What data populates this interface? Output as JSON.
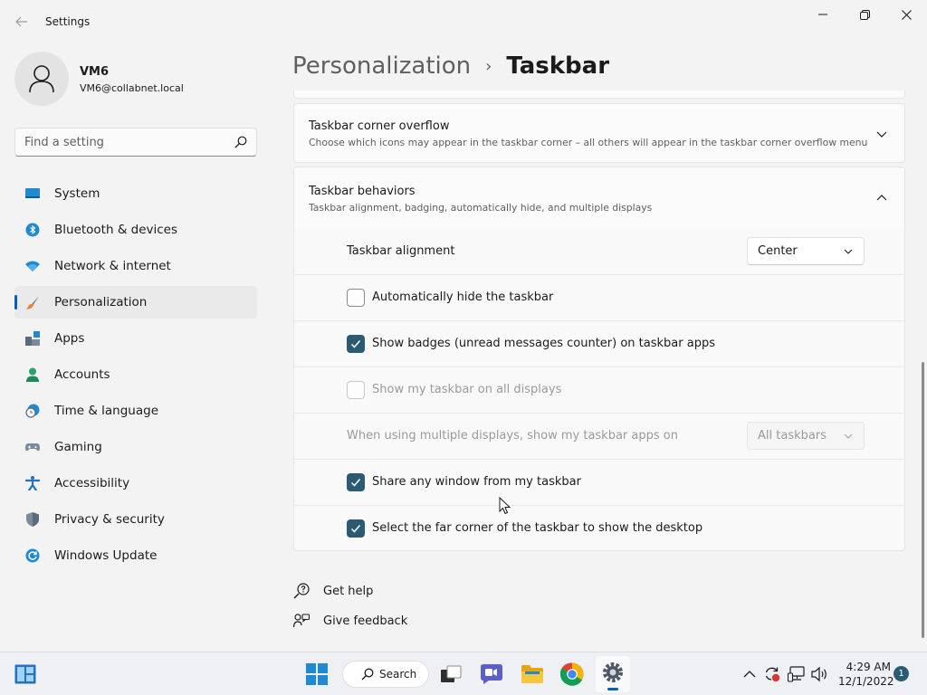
{
  "window": {
    "title": "Settings",
    "back_icon": "arrow-left-icon",
    "controls": [
      "minimize-icon",
      "restore-icon",
      "close-icon"
    ]
  },
  "profile": {
    "name": "VM6",
    "email": "VM6@collabnet.local"
  },
  "search": {
    "placeholder": "Find a setting",
    "icon": "search-icon"
  },
  "sidebar": {
    "items": [
      {
        "label": "System",
        "icon": "system-icon",
        "active": false
      },
      {
        "label": "Bluetooth & devices",
        "icon": "bluetooth-icon",
        "active": false
      },
      {
        "label": "Network & internet",
        "icon": "wifi-icon",
        "active": false
      },
      {
        "label": "Personalization",
        "icon": "brush-icon",
        "active": true
      },
      {
        "label": "Apps",
        "icon": "apps-icon",
        "active": false
      },
      {
        "label": "Accounts",
        "icon": "accounts-icon",
        "active": false
      },
      {
        "label": "Time & language",
        "icon": "clock-globe-icon",
        "active": false
      },
      {
        "label": "Gaming",
        "icon": "gamepad-icon",
        "active": false
      },
      {
        "label": "Accessibility",
        "icon": "accessibility-icon",
        "active": false
      },
      {
        "label": "Privacy & security",
        "icon": "shield-icon",
        "active": false
      },
      {
        "label": "Windows Update",
        "icon": "update-icon",
        "active": false
      }
    ],
    "accent_color": "#005fb8"
  },
  "breadcrumb": {
    "parent": "Personalization",
    "separator": "›",
    "current": "Taskbar"
  },
  "overflow_card": {
    "title": "Taskbar corner overflow",
    "description": "Choose which icons may appear in the taskbar corner – all others will appear in the taskbar corner overflow menu",
    "expanded": false
  },
  "behaviors_card": {
    "title": "Taskbar behaviors",
    "description": "Taskbar alignment, badging, automatically hide, and multiple displays",
    "expanded": true
  },
  "behaviors": {
    "alignment": {
      "label": "Taskbar alignment",
      "value": "Center",
      "enabled": true
    },
    "auto_hide": {
      "label": "Automatically hide the taskbar",
      "checked": false,
      "enabled": true
    },
    "badges": {
      "label": "Show badges (unread messages counter) on taskbar apps",
      "checked": true,
      "enabled": true
    },
    "all_displays": {
      "label": "Show my taskbar on all displays",
      "checked": false,
      "enabled": false
    },
    "multi_display": {
      "label": "When using multiple displays, show my taskbar apps on",
      "value": "All taskbars",
      "enabled": false
    },
    "share_window": {
      "label": "Share any window from my taskbar",
      "checked": true,
      "enabled": true
    },
    "far_corner": {
      "label": "Select the far corner of the taskbar to show the desktop",
      "checked": true,
      "enabled": true
    }
  },
  "help": {
    "get_help": "Get help",
    "give_feedback": "Give feedback"
  },
  "taskbar": {
    "search_label": "Search",
    "apps": [
      "start-icon",
      "task-view-icon",
      "chat-icon",
      "file-explorer-icon",
      "chrome-icon",
      "settings-icon"
    ],
    "tray_icons": [
      "chevron-up-icon",
      "sync-icon",
      "network-icon",
      "volume-icon"
    ],
    "time": "4:29 AM",
    "date": "12/1/2022",
    "notifications": "1"
  },
  "colors": {
    "checkbox_checked": "#2b5b73",
    "accent": "#005fb8",
    "window_bg": "#f3f3f3",
    "card_bg": "#fbfbfb"
  }
}
